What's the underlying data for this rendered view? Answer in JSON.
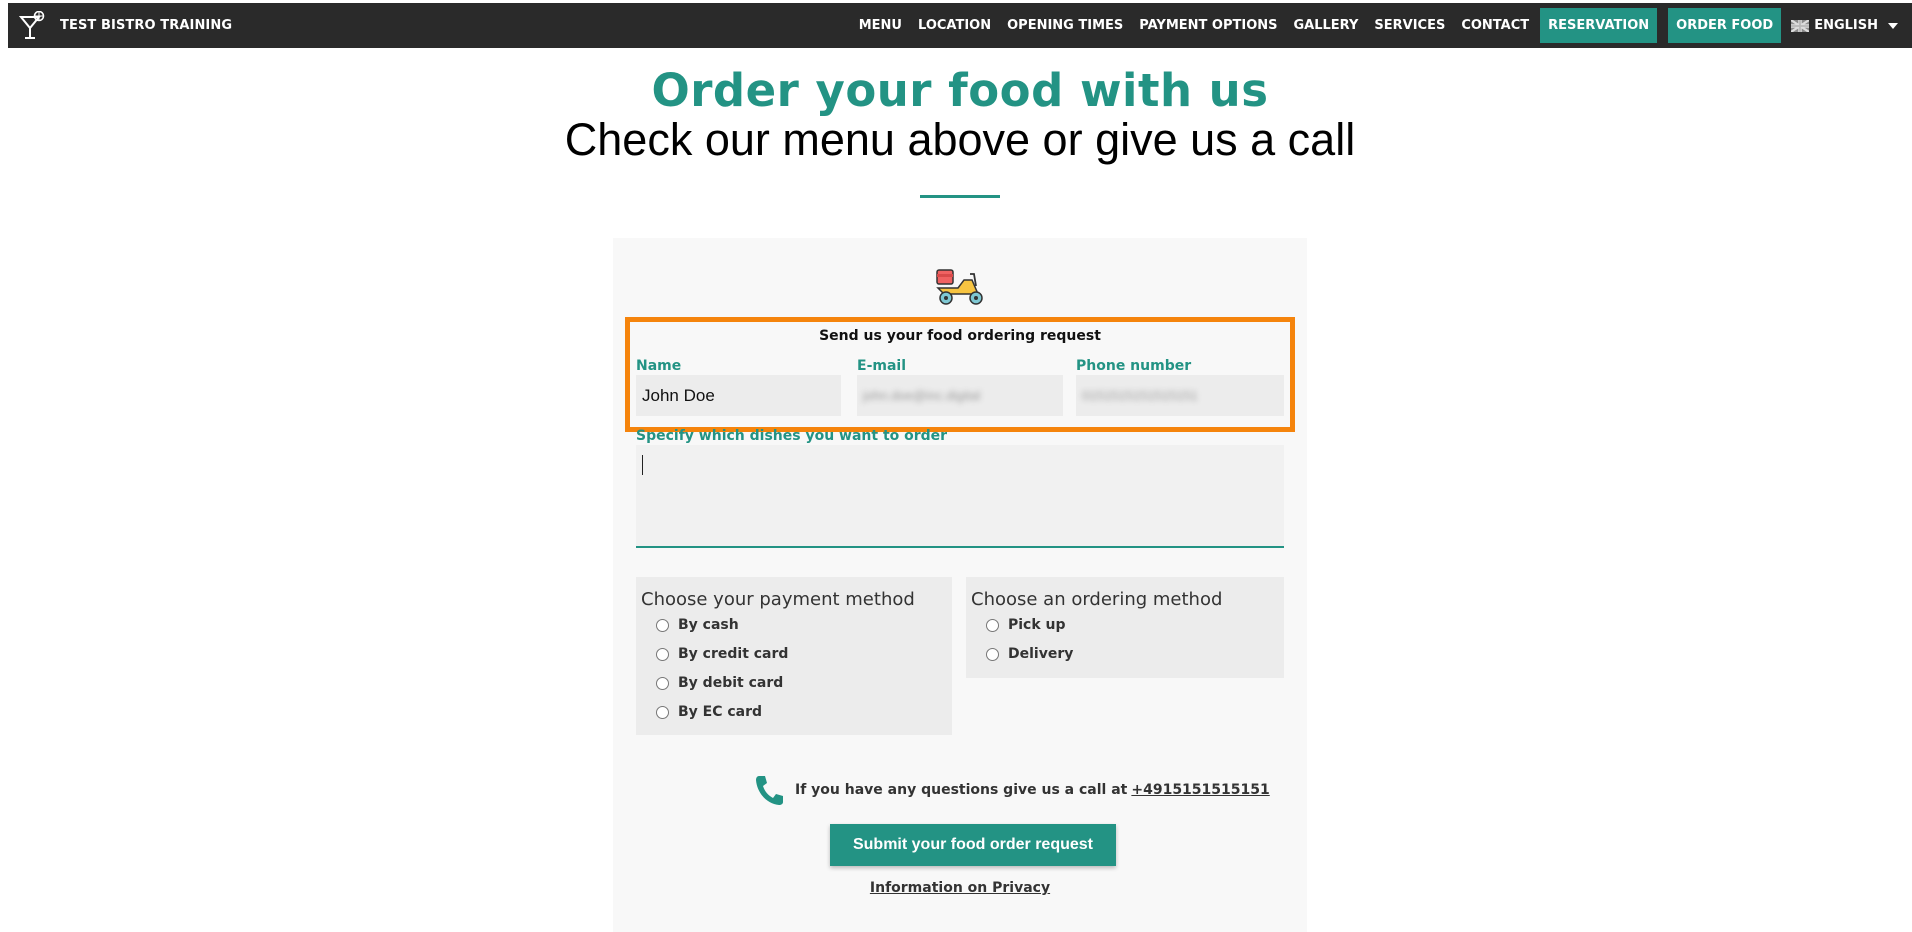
{
  "brand": {
    "name": "TEST BISTRO TRAINING"
  },
  "nav": {
    "items": [
      "MENU",
      "LOCATION",
      "OPENING TIMES",
      "PAYMENT OPTIONS",
      "GALLERY",
      "SERVICES",
      "CONTACT"
    ],
    "reservation": "RESERVATION",
    "order_food": "ORDER FOOD",
    "language": "ENGLISH"
  },
  "heading": {
    "title": "Order your food with us",
    "subtitle": "Check our menu above or give us a call"
  },
  "form": {
    "header": "Send us your food ordering request",
    "name_label": "Name",
    "name_value": "John Doe",
    "email_label": "E-mail",
    "email_value": "john.doe@inc.digital",
    "phone_label": "Phone number",
    "phone_value": "0151515151515151",
    "dishes_label": "Specify which dishes you want to order",
    "dishes_value": ""
  },
  "payment": {
    "title": "Choose your payment method",
    "options": [
      "By cash",
      "By credit card",
      "By debit card",
      "By EC card"
    ]
  },
  "ordering": {
    "title": "Choose an ordering method",
    "options": [
      "Pick up",
      "Delivery"
    ]
  },
  "contact": {
    "text": "If you have any questions give us a call at",
    "phone": "+4915151515151"
  },
  "submit_label": "Submit your food order request",
  "privacy_label": "Information on Privacy",
  "colors": {
    "accent": "#239384",
    "highlight": "#f5840c",
    "topbar": "#2a2a2a"
  }
}
